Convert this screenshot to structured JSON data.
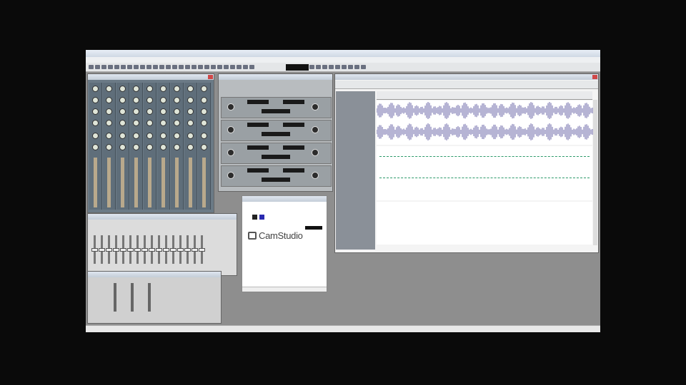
{
  "camstudio": {
    "logo_text": "CamStudio"
  },
  "colors": {
    "waveform": "#6e68a8",
    "midi_line": "#2c9a6a",
    "mixer": "#6b7a86"
  }
}
